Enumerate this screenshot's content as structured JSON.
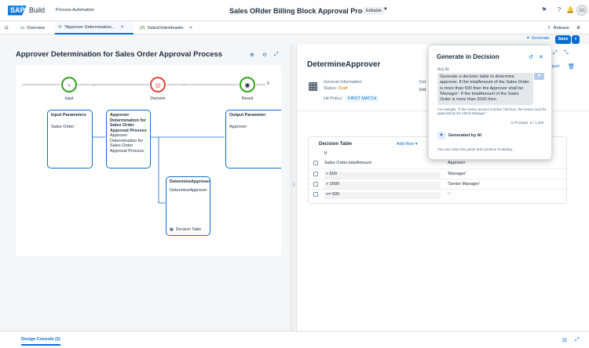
{
  "shell": {
    "brand_logo": "SAP",
    "brand_name": "Build",
    "product": "Process Automation",
    "title": "Sales ORder Billing Block Approval Process",
    "badge": "Editable",
    "avatar": "SS"
  },
  "tabs": [
    {
      "label": "Overview"
    },
    {
      "label": "*Approver Determination..."
    },
    {
      "label": "SalesOrderHeader"
    }
  ],
  "toolbar": {
    "release": "Release",
    "generate": "Generate",
    "save": "Save"
  },
  "left": {
    "title": "Approver Determination for Sales Order Approval Process",
    "flow": {
      "input": "Input",
      "decision": "Decision",
      "result": "Result",
      "end_marker": "0"
    },
    "nodes": {
      "input_title": "Input Parameters",
      "input_body": "Sales Order",
      "approver_title": "Approver Determination for Sales Order Approval Process",
      "approver_body": "Approver Determination for Sales Order Approval Process",
      "output_title": "Output Parameter",
      "output_body": "Approver",
      "det_title": "DetermineApprover",
      "det_body": "DetermineApprover",
      "det_footer": "Decision Table"
    }
  },
  "right": {
    "title": "DetermineApprover",
    "general_label": "General Information:",
    "status_label": "Status:",
    "status_value": "Draft",
    "hit_label": "Hit Policy:",
    "hit_value": "FIRST MATCH",
    "det_label": "Det",
    "det_value": "Det",
    "export_label": "port",
    "table": {
      "title": "Decision Table",
      "add_row": "Add Row",
      "if_label": "If",
      "col1": "Sales Order.totalAmount",
      "col2": "Approver",
      "rows": [
        {
          "cond": "> 500",
          "val": "'Manager'"
        },
        {
          "cond": "> 2000",
          "val": "'Senior Manager'"
        },
        {
          "cond": "<= 500",
          "val": "'-'"
        }
      ]
    }
  },
  "popup": {
    "title": "Generate in Decision",
    "ask_label": "Ask AI:",
    "ask_text": "Generate a decision table to determine approver. If the totalAmount of the Sales Order is more than 500 then the Approver shall be 'Manager'. If the totalAmount of the Sales Order is more than 2000 then",
    "example": "For example, \"If the invoice amount is below 750 Euro, the invoice must be approved by the Admin Manager.\"",
    "prompts": "AI Prompts: 3 / 1,200",
    "generated": "Generated by AI",
    "close_note": "You can close this panel and continue modeling."
  },
  "bottom": {
    "console": "Design Console (1)"
  }
}
